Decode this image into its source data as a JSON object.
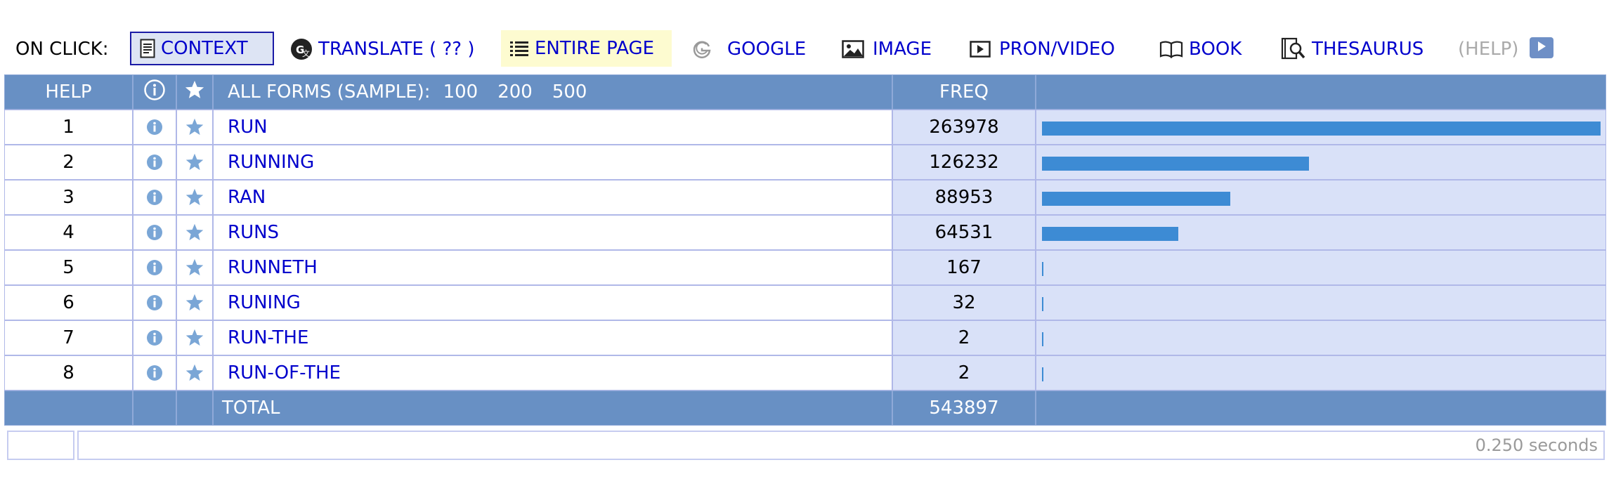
{
  "toolbar": {
    "label": "ON CLICK:",
    "context": "CONTEXT",
    "translate": "TRANSLATE  ( ?? )",
    "entire_page": "ENTIRE PAGE",
    "google": "GOOGLE",
    "image": "IMAGE",
    "pron_video": "PRON/VIDEO",
    "book": "BOOK",
    "thesaurus": "THESAURUS",
    "help": "(HELP)"
  },
  "table": {
    "header": {
      "help": "HELP",
      "all_forms": "ALL FORMS  (SAMPLE):",
      "sample_sizes": [
        "100",
        "200",
        "500"
      ],
      "freq": "FREQ"
    },
    "rows": [
      {
        "rank": "1",
        "word": "RUN",
        "freq": "263978",
        "share": 1.0
      },
      {
        "rank": "2",
        "word": "RUNNING",
        "freq": "126232",
        "share": 0.478
      },
      {
        "rank": "3",
        "word": "RAN",
        "freq": "88953",
        "share": 0.337
      },
      {
        "rank": "4",
        "word": "RUNS",
        "freq": "64531",
        "share": 0.244
      },
      {
        "rank": "5",
        "word": "RUNNETH",
        "freq": "167",
        "share": 0.0006
      },
      {
        "rank": "6",
        "word": "RUNING",
        "freq": "32",
        "share": 0.0001
      },
      {
        "rank": "7",
        "word": "RUN-THE",
        "freq": "2",
        "share": 0.0
      },
      {
        "rank": "8",
        "word": "RUN-OF-THE",
        "freq": "2",
        "share": 0.0
      }
    ],
    "footer": {
      "total_label": "TOTAL",
      "total_value": "543897"
    }
  },
  "status": {
    "elapsed": "0.250 seconds"
  },
  "colors": {
    "header_bg": "#6890c4",
    "freq_bg": "#d9e1f8",
    "bar": "#3d8bd4",
    "link": "#0000cc",
    "icon": "#7aa6d6"
  }
}
